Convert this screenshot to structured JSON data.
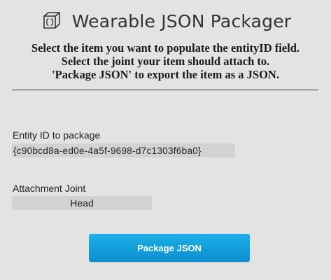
{
  "header": {
    "title": "Wearable JSON Packager",
    "logo_icon": "cube-icon"
  },
  "instructions": {
    "line1": "Select the item you want to populate the entityID field.",
    "line2": "Select the joint your item should attach to.",
    "line3": "'Package JSON' to export the item as a JSON."
  },
  "entity": {
    "label": "Entity ID to package",
    "value": "{c90bcd8a-ed0e-4a5f-9698-d7c1303f6ba0}"
  },
  "joint": {
    "label": "Attachment Joint",
    "selected": "Head"
  },
  "actions": {
    "package_label": "Package JSON"
  },
  "colors": {
    "background": "#e3e3e3",
    "field": "#d2d2d2",
    "button_accent": "#12a0dd"
  }
}
